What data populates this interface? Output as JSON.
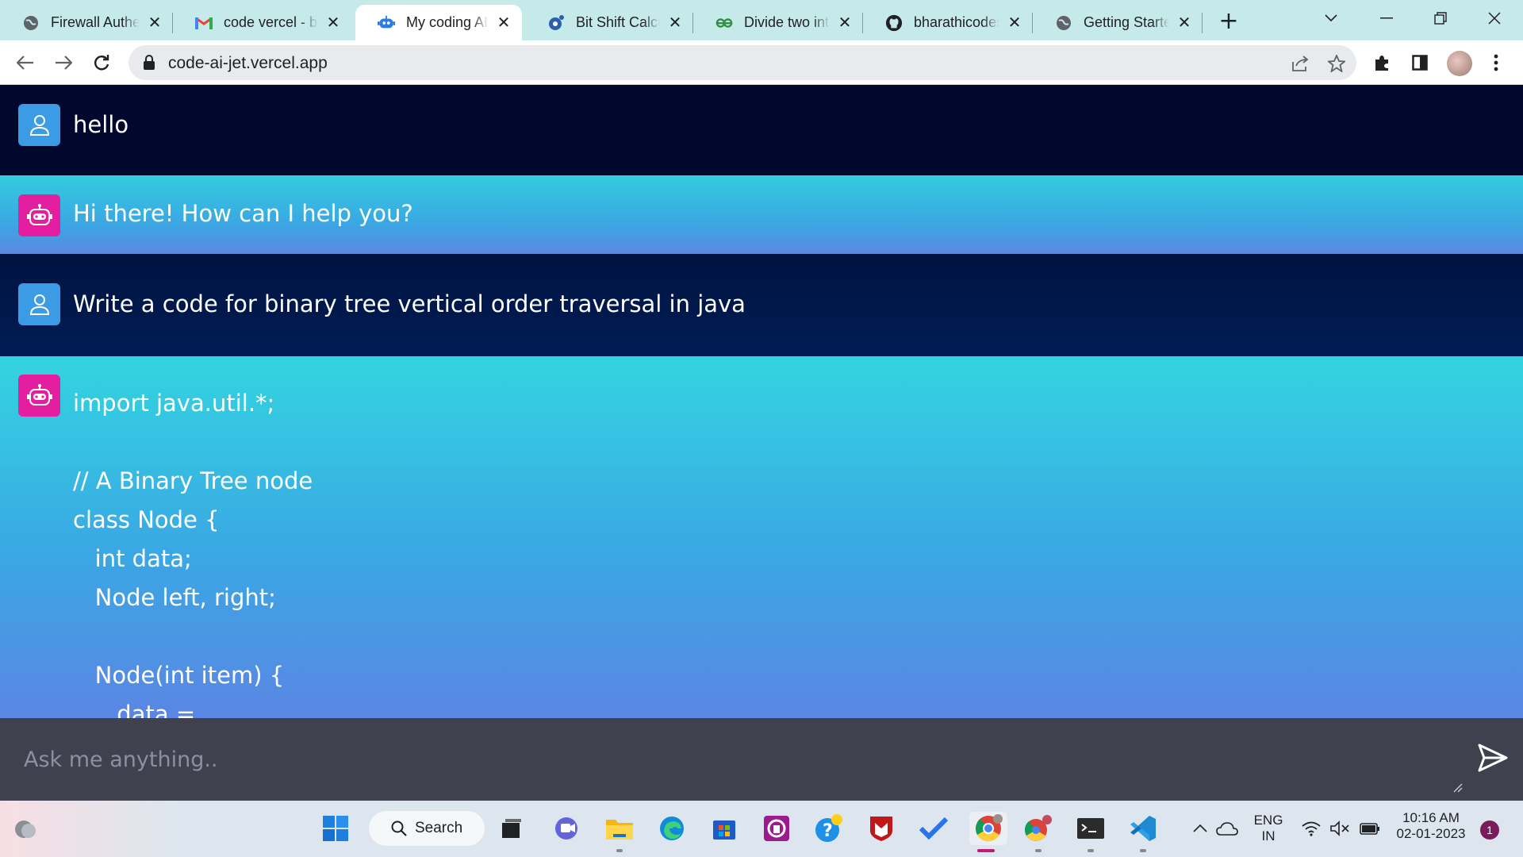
{
  "browser": {
    "tabs": [
      {
        "title": "Firewall Authentication",
        "favicon": "globe-icon"
      },
      {
        "title": "code vercel - b",
        "favicon": "gmail-icon"
      },
      {
        "title": "My coding AI",
        "favicon": "robot-icon",
        "active": true
      },
      {
        "title": "Bit Shift Calculator",
        "favicon": "bitshift-icon"
      },
      {
        "title": "Divide two integers",
        "favicon": "gfg-icon"
      },
      {
        "title": "bharathicodes",
        "favicon": "github-icon"
      },
      {
        "title": "Getting Started",
        "favicon": "globe-icon"
      }
    ],
    "close_glyph": "✕",
    "new_tab_glyph": "+",
    "url": "code-ai-jet.vercel.app"
  },
  "chat": {
    "messages": [
      {
        "role": "user",
        "text": "hello"
      },
      {
        "role": "bot",
        "text": "Hi there! How can I help you?"
      },
      {
        "role": "user",
        "text": "Write a code for binary tree vertical order traversal in java"
      },
      {
        "role": "bot",
        "text": "import java.util.*;\n\n// A Binary Tree node\nclass Node {\n   int data;\n   Node left, right;\n\n   Node(int item) {\n      data ="
      }
    ],
    "input_placeholder": "Ask me anything.."
  },
  "taskbar": {
    "search_label": "Search",
    "language": "ENG",
    "region": "IN",
    "time": "10:16 AM",
    "date": "02-01-2023",
    "notification_count": "1"
  },
  "colors": {
    "user_bg": "#00082d",
    "bot_gradient_top": "#33ccdf",
    "bot_gradient_bottom": "#5b88e3",
    "user_avatar": "#3b9be4",
    "bot_avatar": "#e31ea0",
    "input_bg": "#40414f"
  }
}
